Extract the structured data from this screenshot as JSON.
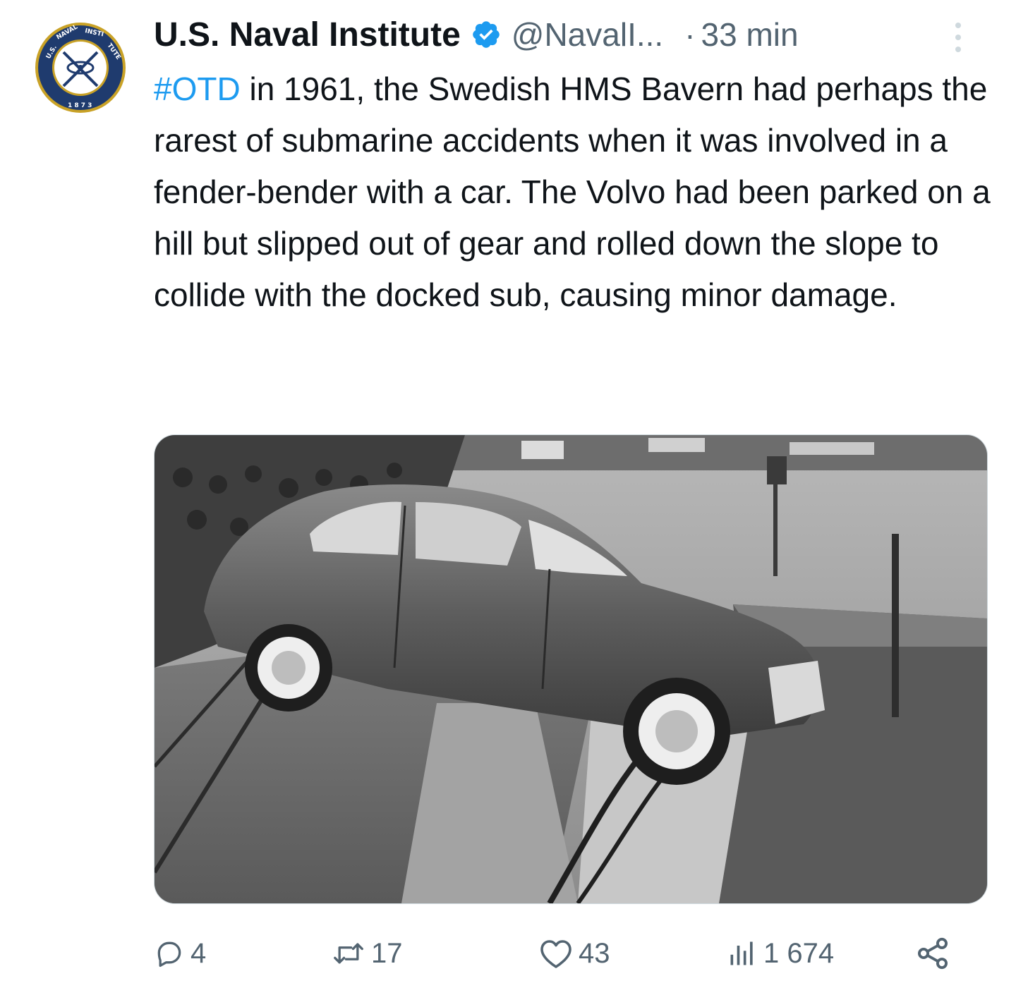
{
  "account": {
    "display_name": "U.S. Naval Institute",
    "handle": "@NavalI...",
    "time_separator": "·",
    "timestamp": "33 min",
    "verified_icon": "verified-badge-icon",
    "avatar_icon": "naval-institute-seal-logo",
    "avatar_seal_text": "U.S. NAVAL INSTITUTE 1873"
  },
  "tweet": {
    "hashtag": "#OTD",
    "body": " in 1961, the Swedish HMS Bavern had perhaps the rarest of submarine accidents when it was involved in a fender-bender with a car. The Volvo had been parked on a hill but slipped out of gear and rolled down the slope to collide with the docked sub, causing minor damage."
  },
  "media": {
    "type": "photo",
    "icon": "black-and-white-photo-car-on-submarine"
  },
  "actions": {
    "replies": {
      "icon": "reply-icon",
      "count": "4"
    },
    "reposts": {
      "icon": "repost-icon",
      "count": "17"
    },
    "likes": {
      "icon": "heart-icon",
      "count": "43"
    },
    "views": {
      "icon": "views-chart-icon",
      "count": "1 674"
    },
    "share": {
      "icon": "share-icon"
    }
  },
  "colors": {
    "link": "#1d9bf0",
    "secondary_text": "#536471",
    "primary_text": "#0f1419",
    "seal_navy": "#1f3b6e",
    "seal_gold": "#c9a227"
  }
}
